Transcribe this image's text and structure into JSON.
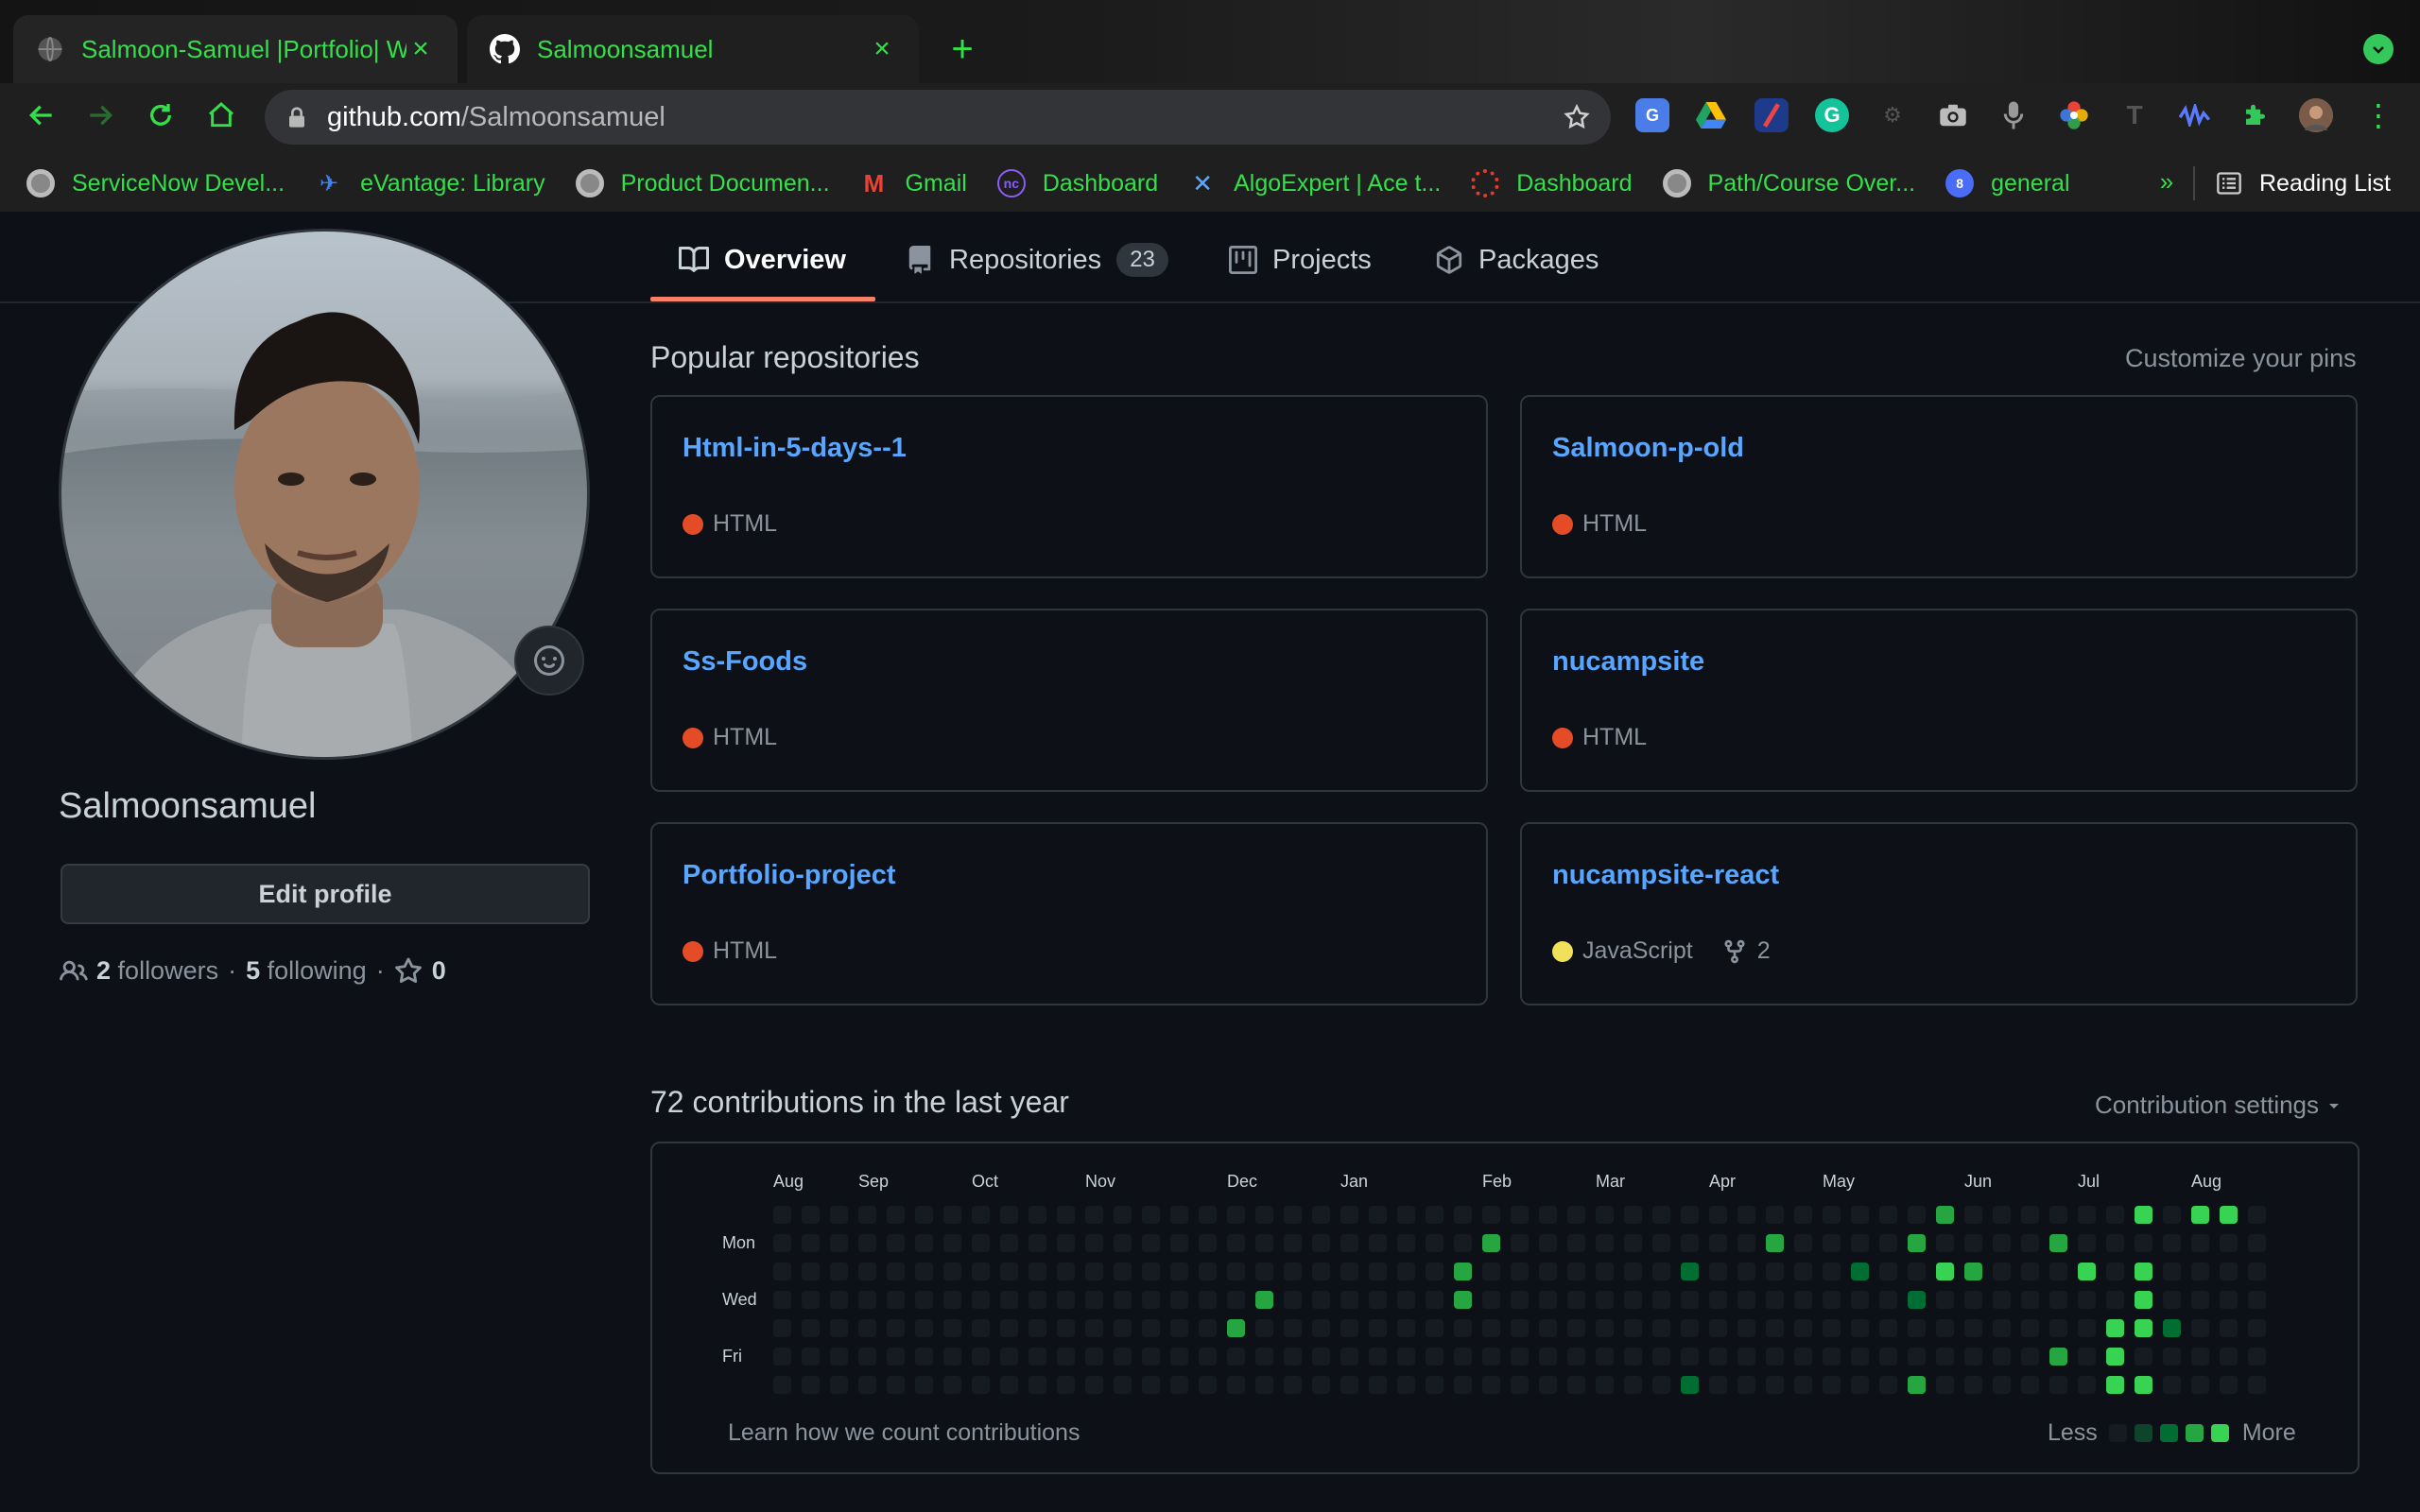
{
  "browser": {
    "tabs": [
      {
        "title": "Salmoon-Samuel |Portfolio| We",
        "icon": "globe-icon",
        "active": false
      },
      {
        "title": "Salmoonsamuel",
        "icon": "github-icon",
        "active": true
      }
    ],
    "new_tab": "+",
    "url_host": "github.com",
    "url_path": "/Salmoonsamuel",
    "bookmarks": [
      {
        "label": "ServiceNow Devel...",
        "icon": "servicenow-icon"
      },
      {
        "label": "eVantage: Library",
        "icon": "bird-icon"
      },
      {
        "label": "Product Documen...",
        "icon": "servicenow-icon"
      },
      {
        "label": "Gmail",
        "icon": "gmail-icon"
      },
      {
        "label": "Dashboard",
        "icon": "nucamp-icon"
      },
      {
        "label": "AlgoExpert | Ace t...",
        "icon": "algoexpert-icon"
      },
      {
        "label": "Dashboard",
        "icon": "canvas-icon"
      },
      {
        "label": "Path/Course Over...",
        "icon": "servicenow-icon"
      },
      {
        "label": "general",
        "icon": "slack-icon"
      }
    ],
    "bookmarks_overflow": "»",
    "reading_list": "Reading List"
  },
  "profile": {
    "username": "Salmoonsamuel",
    "edit_button": "Edit profile",
    "followers_count": "2",
    "followers_label": "followers",
    "following_count": "5",
    "following_label": "following",
    "stars_count": "0",
    "separator": "·"
  },
  "tabs": [
    {
      "label": "Overview",
      "count": null,
      "selected": true,
      "icon": "book-icon"
    },
    {
      "label": "Repositories",
      "count": "23",
      "selected": false,
      "icon": "repo-icon"
    },
    {
      "label": "Projects",
      "count": null,
      "selected": false,
      "icon": "project-icon"
    },
    {
      "label": "Packages",
      "count": null,
      "selected": false,
      "icon": "package-icon"
    }
  ],
  "popular": {
    "heading": "Popular repositories",
    "customize": "Customize your pins",
    "repos": [
      {
        "name": "Html-in-5-days--1",
        "language": "HTML",
        "lang_color": "#e34c26",
        "forks": null
      },
      {
        "name": "Salmoon-p-old",
        "language": "HTML",
        "lang_color": "#e34c26",
        "forks": null
      },
      {
        "name": "Ss-Foods",
        "language": "HTML",
        "lang_color": "#e34c26",
        "forks": null
      },
      {
        "name": "nucampsite",
        "language": "HTML",
        "lang_color": "#e34c26",
        "forks": null
      },
      {
        "name": "Portfolio-project",
        "language": "HTML",
        "lang_color": "#e34c26",
        "forks": null
      },
      {
        "name": "nucampsite-react",
        "language": "JavaScript",
        "lang_color": "#f1e05a",
        "forks": "2"
      }
    ]
  },
  "contributions": {
    "heading": "72 contributions in the last year",
    "settings": "Contribution settings",
    "months": [
      "Aug",
      "Sep",
      "Oct",
      "Nov",
      "Dec",
      "Jan",
      "Feb",
      "Mar",
      "Apr",
      "May",
      "Jun",
      "Jul",
      "Aug"
    ],
    "days": [
      "Mon",
      "Wed",
      "Fri"
    ],
    "learn": "Learn how we count contributions",
    "less": "Less",
    "more": "More",
    "levels_colors": [
      "#161b22",
      "#0e4429",
      "#006d32",
      "#26a641",
      "#39d353"
    ],
    "active_cells": [
      {
        "week": 16,
        "day": 4,
        "level": 3
      },
      {
        "week": 17,
        "day": 3,
        "level": 3
      },
      {
        "week": 24,
        "day": 2,
        "level": 3
      },
      {
        "week": 24,
        "day": 3,
        "level": 3
      },
      {
        "week": 25,
        "day": 1,
        "level": 3
      },
      {
        "week": 32,
        "day": 2,
        "level": 2
      },
      {
        "week": 32,
        "day": 6,
        "level": 2
      },
      {
        "week": 35,
        "day": 1,
        "level": 3
      },
      {
        "week": 38,
        "day": 2,
        "level": 2
      },
      {
        "week": 40,
        "day": 1,
        "level": 3
      },
      {
        "week": 40,
        "day": 3,
        "level": 2
      },
      {
        "week": 40,
        "day": 6,
        "level": 3
      },
      {
        "week": 41,
        "day": 0,
        "level": 3
      },
      {
        "week": 41,
        "day": 2,
        "level": 4
      },
      {
        "week": 42,
        "day": 2,
        "level": 3
      },
      {
        "week": 45,
        "day": 1,
        "level": 3
      },
      {
        "week": 45,
        "day": 5,
        "level": 3
      },
      {
        "week": 46,
        "day": 2,
        "level": 4
      },
      {
        "week": 47,
        "day": 4,
        "level": 4
      },
      {
        "week": 47,
        "day": 5,
        "level": 4
      },
      {
        "week": 47,
        "day": 6,
        "level": 4
      },
      {
        "week": 48,
        "day": 0,
        "level": 4
      },
      {
        "week": 48,
        "day": 2,
        "level": 4
      },
      {
        "week": 48,
        "day": 3,
        "level": 4
      },
      {
        "week": 48,
        "day": 4,
        "level": 4
      },
      {
        "week": 48,
        "day": 6,
        "level": 4
      },
      {
        "week": 49,
        "day": 4,
        "level": 2
      },
      {
        "week": 50,
        "day": 0,
        "level": 4
      },
      {
        "week": 51,
        "day": 0,
        "level": 4
      }
    ]
  }
}
